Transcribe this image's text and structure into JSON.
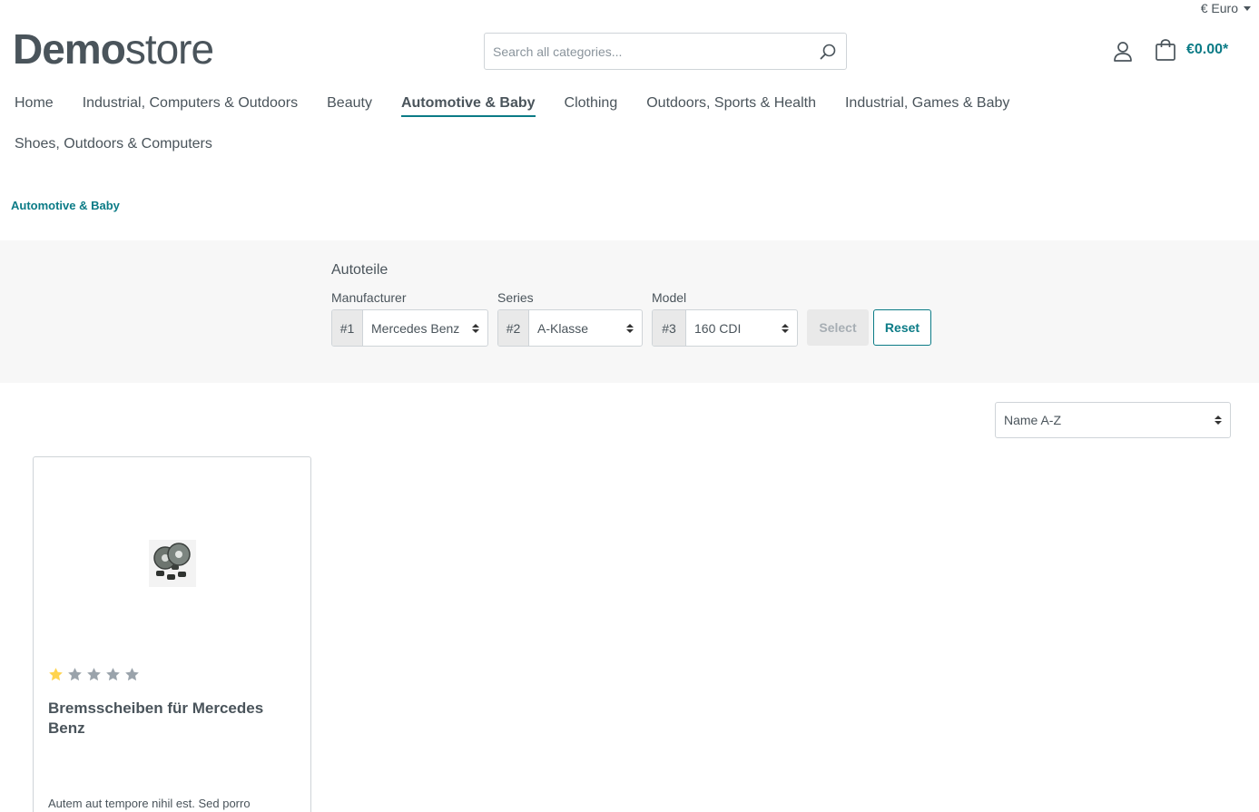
{
  "header": {
    "currency_label": "€ Euro",
    "logo_bold": "Demo",
    "logo_light": "store",
    "search_placeholder": "Search all categories...",
    "cart_total": "€0.00*"
  },
  "nav": {
    "items": [
      {
        "label": "Home",
        "active": false
      },
      {
        "label": "Industrial, Computers & Outdoors",
        "active": false
      },
      {
        "label": "Beauty",
        "active": false
      },
      {
        "label": "Automotive & Baby",
        "active": true
      },
      {
        "label": "Clothing",
        "active": false
      },
      {
        "label": "Outdoors, Sports & Health",
        "active": false
      },
      {
        "label": "Industrial, Games & Baby",
        "active": false
      },
      {
        "label": "Shoes, Outdoors & Computers",
        "active": false
      }
    ]
  },
  "breadcrumb": {
    "current": "Automotive & Baby"
  },
  "filter": {
    "title": "Autoteile",
    "fields": [
      {
        "label": "Manufacturer",
        "prefix": "#1",
        "value": "Mercedes Benz"
      },
      {
        "label": "Series",
        "prefix": "#2",
        "value": "A-Klasse"
      },
      {
        "label": "Model",
        "prefix": "#3",
        "value": "160 CDI"
      }
    ],
    "select_label": "Select",
    "reset_label": "Reset"
  },
  "sorting": {
    "selected": "Name A-Z"
  },
  "products": [
    {
      "name": "Bremsscheiben für Mercedes Benz",
      "rating": 1,
      "rating_max": 5,
      "description": "Autem aut tempore nihil est. Sed porro"
    }
  ],
  "colors": {
    "accent": "#0b7b86",
    "text": "#4a545b",
    "star_filled": "#ffd44f",
    "star_empty": "#9aa3ab",
    "band_bg": "#f7f7f7"
  }
}
